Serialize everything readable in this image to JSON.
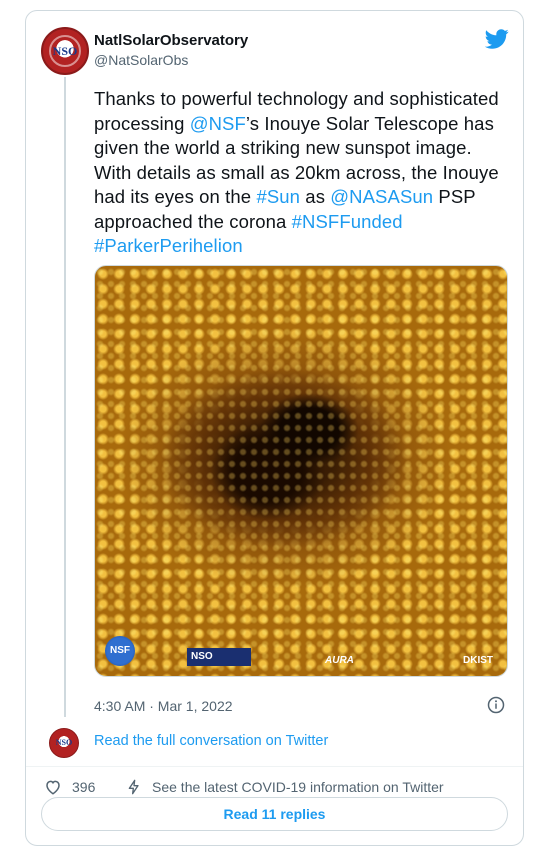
{
  "author": {
    "display_name": "NatlSolarObservatory",
    "handle": "@NatSolarObs",
    "avatar_text": "NSO"
  },
  "tweet": {
    "text_1": "Thanks to powerful technology and sophisticated processing ",
    "mention_nsf": "@NSF",
    "text_2": "’s Inouye Solar Telescope has given the world a striking new sunspot image. With details as small as 20km across, the Inouye had its eyes on the ",
    "hashtag_sun": "#Sun",
    "text_3": " as ",
    "mention_nasasun": "@NASASun",
    "text_4": " PSP approached the corona ",
    "hashtag_nsffunded": "#NSFFunded",
    "text_5": " ",
    "hashtag_parker": "#ParkerPerihelion"
  },
  "media": {
    "logo_nsf": "NSF",
    "logo_nso": "NSO",
    "logo_aura": "AURA",
    "logo_dkist": "DKIST"
  },
  "timestamp": "4:30 AM · Mar 1, 2022",
  "read_conversation": "Read the full conversation on Twitter",
  "likes_count": "396",
  "covid_info": "See the latest COVID-19 information on Twitter",
  "replies_button": "Read 11 replies",
  "colors": {
    "link": "#1d9bf0",
    "text": "#0f1419",
    "secondary": "#536471",
    "border": "#cfd9de"
  },
  "icons": {
    "brand": "twitter-bird-icon",
    "info": "info-icon",
    "like": "heart-icon",
    "covid": "lightning-icon"
  }
}
